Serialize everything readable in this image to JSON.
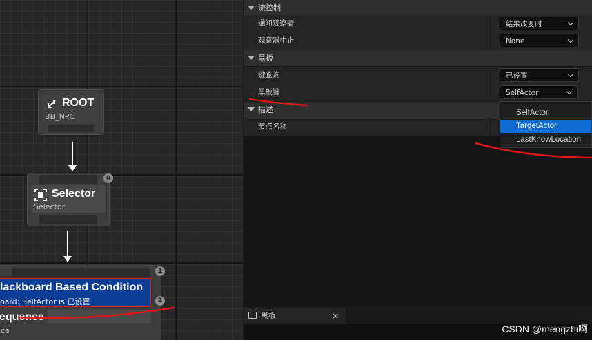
{
  "graph": {
    "root": {
      "title": "ROOT",
      "subtitle": "BB_NPC"
    },
    "selector": {
      "title": "Selector",
      "subtitle": "Selector",
      "index": "0"
    },
    "decorator": {
      "title": "lackboard Based Condition",
      "subtitle": "oard: SelfActor is 已设置",
      "index": "2"
    },
    "sequence": {
      "title": "equence",
      "subtitle": "ce",
      "index": "1"
    }
  },
  "details": {
    "flow_control": {
      "label": "流控制",
      "notify_observer": {
        "name": "通知观察者",
        "value": "结果改变时"
      },
      "observer_aborts": {
        "name": "观察器中止",
        "value": "None"
      }
    },
    "blackboard": {
      "label": "黑板",
      "key_query": {
        "name": "键查询",
        "value": "已设置"
      },
      "blackboard_key": {
        "name": "黑板键",
        "value": "SelfActor"
      }
    },
    "description": {
      "label": "描述",
      "node_name": {
        "name": "节点名称"
      }
    },
    "dropdown": {
      "options": [
        "SelfActor",
        "TargetActor",
        "LastKnowLocation"
      ],
      "selected_index": 1
    }
  },
  "bottom_panel": {
    "tab_label": "黑板",
    "close": "×"
  },
  "watermark": "CSDN @mengzhi啊",
  "colors": {
    "selected": "#0e6cd3",
    "decorator": "#0c3e96",
    "annotation": "#e0161b"
  }
}
